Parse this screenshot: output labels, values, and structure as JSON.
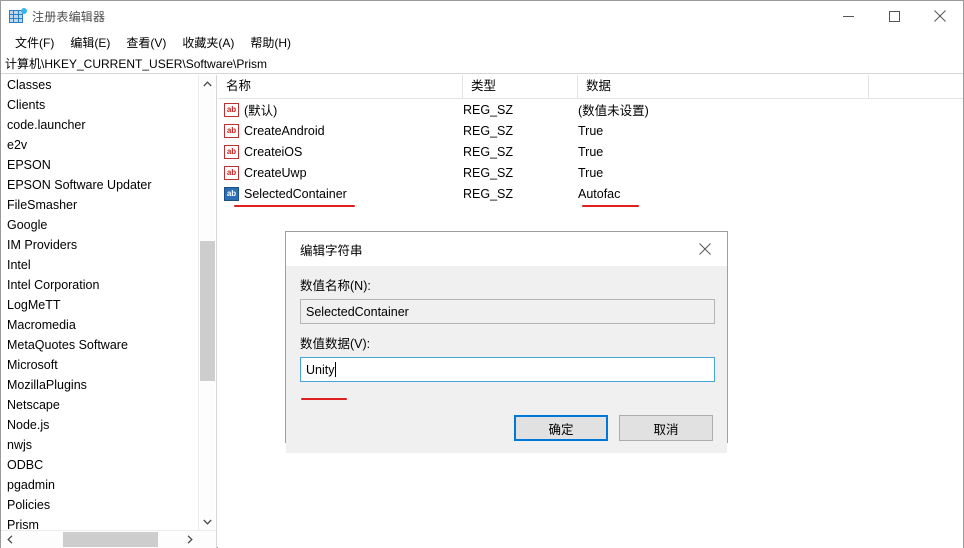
{
  "window": {
    "title": "注册表编辑器",
    "icon": "registry-grid-icon",
    "controls": {
      "minimize": "minimize-icon",
      "maximize": "maximize-icon",
      "close": "close-icon"
    }
  },
  "menubar": {
    "items": [
      {
        "label": "文件(F)"
      },
      {
        "label": "编辑(E)"
      },
      {
        "label": "查看(V)"
      },
      {
        "label": "收藏夹(A)"
      },
      {
        "label": "帮助(H)"
      }
    ]
  },
  "address": {
    "path": "计算机\\HKEY_CURRENT_USER\\Software\\Prism"
  },
  "tree": {
    "items": [
      {
        "label": "Classes"
      },
      {
        "label": "Clients"
      },
      {
        "label": "code.launcher"
      },
      {
        "label": "e2v"
      },
      {
        "label": "EPSON"
      },
      {
        "label": "EPSON Software Updater"
      },
      {
        "label": "FileSmasher"
      },
      {
        "label": "Google"
      },
      {
        "label": "IM Providers"
      },
      {
        "label": "Intel"
      },
      {
        "label": "Intel Corporation"
      },
      {
        "label": "LogMeTT"
      },
      {
        "label": "Macromedia"
      },
      {
        "label": "MetaQuotes Software"
      },
      {
        "label": "Microsoft"
      },
      {
        "label": "MozillaPlugins"
      },
      {
        "label": "Netscape"
      },
      {
        "label": "Node.js"
      },
      {
        "label": "nwjs"
      },
      {
        "label": "ODBC"
      },
      {
        "label": "pgadmin"
      },
      {
        "label": "Policies"
      },
      {
        "label": "Prism"
      }
    ]
  },
  "list": {
    "columns": [
      {
        "label": "名称"
      },
      {
        "label": "类型"
      },
      {
        "label": "数据"
      }
    ],
    "rows": [
      {
        "name": "(默认)",
        "type": "REG_SZ",
        "data": "(数值未设置)",
        "icon": "ab-string-icon",
        "selected": false
      },
      {
        "name": "CreateAndroid",
        "type": "REG_SZ",
        "data": "True",
        "icon": "ab-string-icon",
        "selected": false
      },
      {
        "name": "CreateiOS",
        "type": "REG_SZ",
        "data": "True",
        "icon": "ab-string-icon",
        "selected": false
      },
      {
        "name": "CreateUwp",
        "type": "REG_SZ",
        "data": "True",
        "icon": "ab-string-icon",
        "selected": false
      },
      {
        "name": "SelectedContainer",
        "type": "REG_SZ",
        "data": "Autofac",
        "icon": "ab-string-icon",
        "selected": true
      }
    ]
  },
  "dialog": {
    "title": "编辑字符串",
    "close_icon": "close-icon",
    "name_label": "数值名称(N):",
    "name_value": "SelectedContainer",
    "data_label": "数值数据(V):",
    "data_value": "Unity",
    "ok_label": "确定",
    "cancel_label": "取消"
  },
  "colors": {
    "accent": "#0078d7",
    "annotation": "#e02020",
    "selected_icon": "#2a6fb5",
    "dialog_bg": "#f0f0f0"
  }
}
